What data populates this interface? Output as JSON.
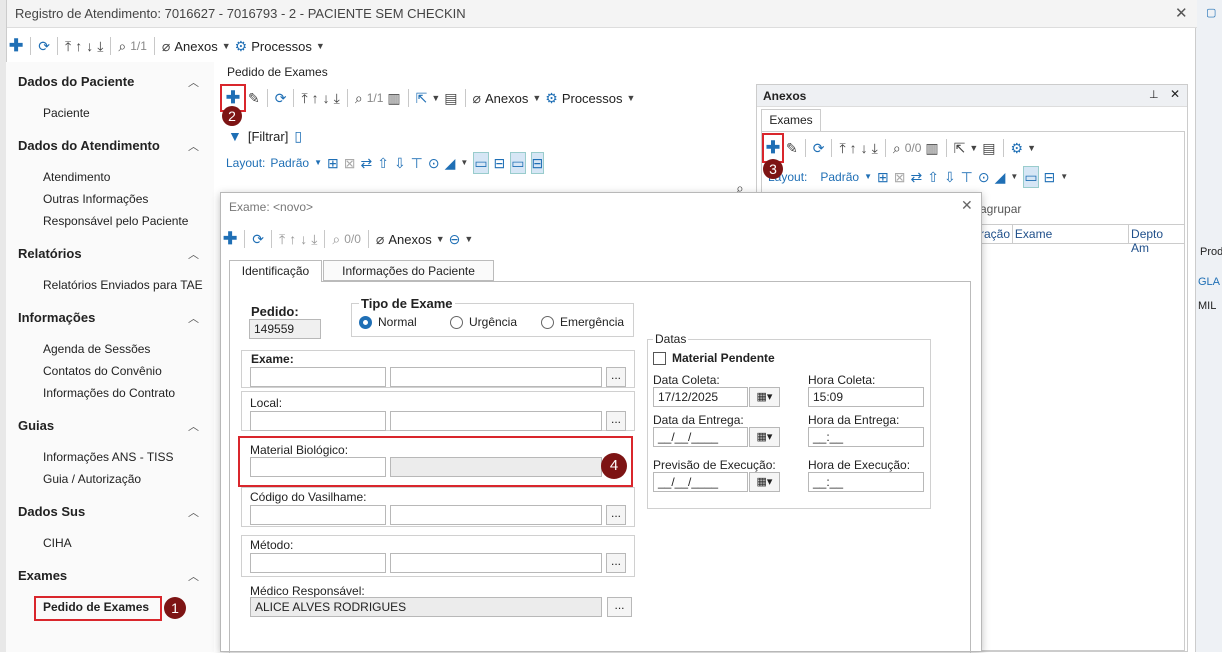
{
  "window": {
    "title": "Registro de Atendimento: 7016627 - 7016793 - 2 - PACIENTE SEM CHECKIN",
    "close": "✕"
  },
  "main_toolbar": {
    "counter": "1/1",
    "anexos": "Anexos",
    "processos": "Processos"
  },
  "sidebar": {
    "sections": [
      {
        "title": "Dados do Paciente",
        "items": [
          "Paciente"
        ]
      },
      {
        "title": "Dados do Atendimento",
        "items": [
          "Atendimento",
          "Outras Informações",
          "Responsável pelo Paciente"
        ]
      },
      {
        "title": "Relatórios",
        "items": [
          "Relatórios Enviados para TAE"
        ]
      },
      {
        "title": "Informações",
        "items": [
          "Agenda de Sessões",
          "Contatos do Convênio",
          "Informações do Contrato"
        ]
      },
      {
        "title": "Guias",
        "items": [
          "Informações ANS - TISS",
          "Guia / Autorização"
        ]
      },
      {
        "title": "Dados Sus",
        "items": [
          "CIHA"
        ]
      },
      {
        "title": "Exames",
        "items": [
          "Pedido de Exames"
        ]
      }
    ]
  },
  "pedido": {
    "title": "Pedido de Exames",
    "counter": "1/1",
    "anexos": "Anexos",
    "processos": "Processos",
    "filtrar": "[Filtrar]",
    "layout_label": "Layout:",
    "layout_value": "Padrão"
  },
  "anexos_panel": {
    "title": "Anexos",
    "tab": "Exames",
    "counter": "0/0",
    "layout_label": "Layout:",
    "layout_value": "Padrão",
    "agrupar": "agrupar",
    "col_duracao": "ração",
    "col_exame": "Exame",
    "col_depto": "Depto Am"
  },
  "right_strip": {
    "prod": "Prod",
    "gla": "GLA",
    "mil": "MIL"
  },
  "badges": {
    "b1": "1",
    "b2": "2",
    "b3": "3",
    "b4": "4"
  },
  "dialog": {
    "title": "Exame: <novo>",
    "counter": "0/0",
    "anexos": "Anexos",
    "tabs": [
      "Identificação",
      "Informações do Paciente"
    ],
    "pedido_label": "Pedido:",
    "pedido_value": "149559",
    "tipo_label": "Tipo de Exame",
    "tipo_options": [
      "Normal",
      "Urgência",
      "Emergência"
    ],
    "exame_label": "Exame:",
    "local_label": "Local:",
    "material_label": "Material Biológico:",
    "vasilhame_label": "Código do Vasilhame:",
    "metodo_label": "Método:",
    "medico_label": "Médico Responsável:",
    "medico_value": "ALICE ALVES RODRIGUES",
    "ellipsis": "...",
    "datas": {
      "group": "Datas",
      "material_pendente": "Material Pendente",
      "data_coleta": "Data Coleta:",
      "data_coleta_value": "17/12/2025",
      "hora_coleta": "Hora Coleta:",
      "hora_coleta_value": "15:09",
      "data_entrega": "Data da Entrega:",
      "data_entrega_value": "__/__/____",
      "hora_entrega": "Hora da Entrega:",
      "hora_entrega_value": "__:__",
      "previsao": "Previsão de Execução:",
      "previsao_value": "__/__/____",
      "hora_exec": "Hora de Execução:",
      "hora_exec_value": "__:__"
    }
  }
}
